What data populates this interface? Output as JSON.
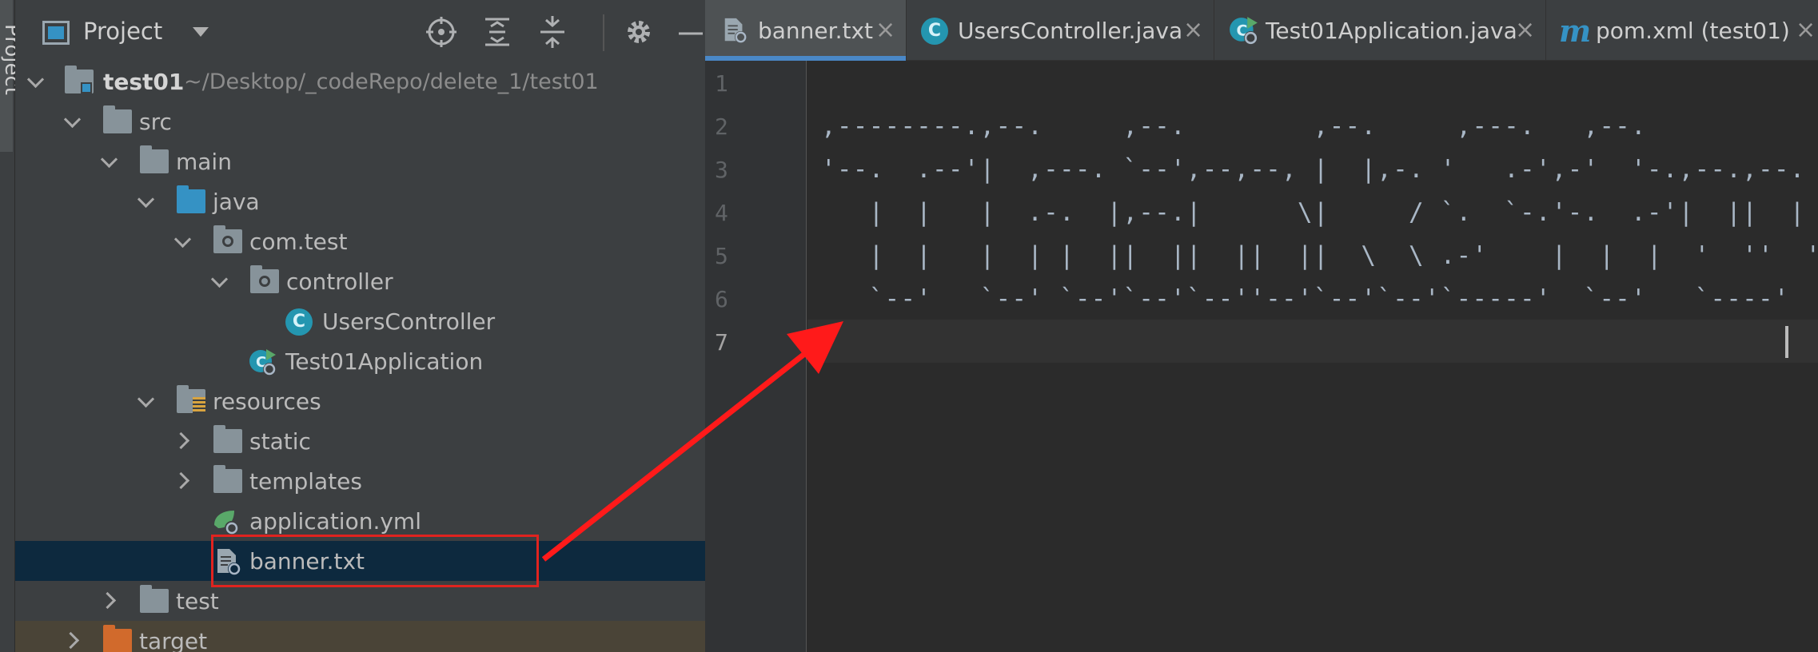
{
  "side_strip": {
    "label": "Project"
  },
  "project_panel": {
    "title": "Project",
    "toolbar": {
      "locate_icon": "crosshair-icon",
      "expand_icon": "expand-all-icon",
      "collapse_icon": "collapse-all-icon",
      "settings_icon": "gear-icon",
      "hide_icon": "minimize-icon"
    },
    "tree": {
      "root_name": "test01",
      "root_path": "~/Desktop/_codeRepo/delete_1/test01",
      "src": "src",
      "main": "main",
      "java": "java",
      "com_test": "com.test",
      "controller": "controller",
      "users_controller": "UsersController",
      "test01_application": "Test01Application",
      "resources": "resources",
      "static": "static",
      "templates": "templates",
      "application_yml": "application.yml",
      "banner_txt": "banner.txt",
      "test": "test",
      "target": "target"
    }
  },
  "editor": {
    "tabs": [
      {
        "label": "banner.txt",
        "active": true
      },
      {
        "label": "UsersController.java",
        "active": false
      },
      {
        "label": "Test01Application.java",
        "active": false
      },
      {
        "label": "pom.xml (test01)",
        "active": false
      }
    ],
    "close_glyph": "×",
    "class_icon_letter": "C",
    "maven_icon_letter": "m",
    "line_numbers": [
      "1",
      "2",
      "3",
      "4",
      "5",
      "6",
      "7"
    ],
    "lines": [
      "",
      ",--------.,--.     ,--.        ,--.     ,---.   ,--.",
      "'--.  .--'|  ,---. `--',--,--, |  |,-. '   .-',-'  '-.,--.,--.",
      "   |  |   |  .-.  |,--.|      \\|     / `.  `-.'-.  .-'|  ||  |",
      "   |  |   |  | |  ||  ||  ||  ||  \\  \\ .-'    |  |  |  '  ''  '",
      "   `--'   `--' `--'`--'`--''--'`--'`--'`-----'  `--'   `----'",
      ""
    ],
    "current_line": 7
  },
  "colors": {
    "annotation_red": "#ff1a1a",
    "selection_blue": "#0d293e",
    "active_tab_underline": "#4a88c7"
  }
}
